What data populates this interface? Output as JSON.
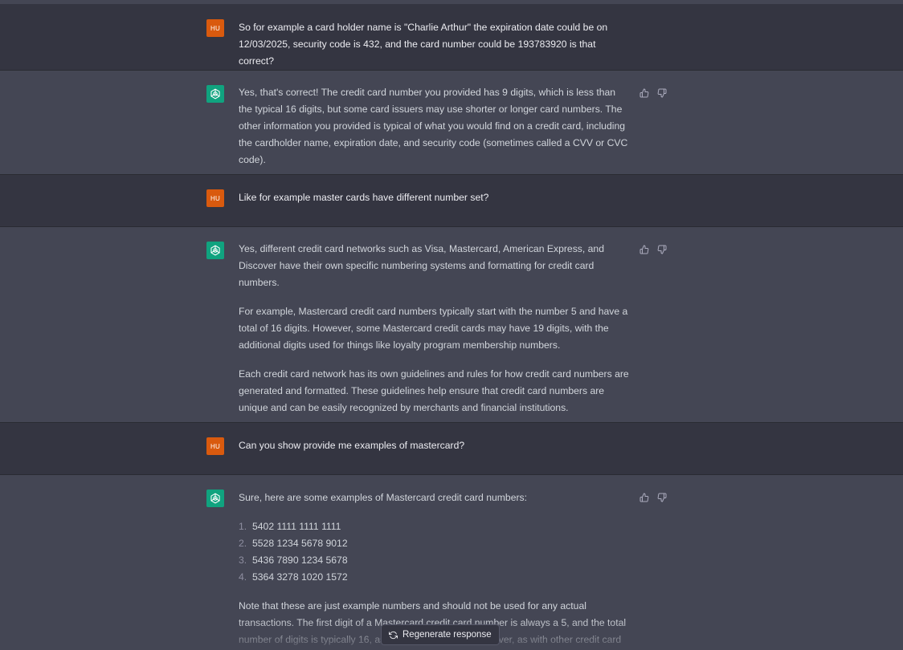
{
  "conversation": {
    "messages": [
      {
        "role": "user",
        "avatar_text": "HU",
        "paragraphs": [
          "So for example a card holder name is \"Charlie Arthur\" the expiration date could be on 12/03/2025, security code is 432, and the card number could be 193783920 is that correct?"
        ]
      },
      {
        "role": "assistant",
        "paragraphs": [
          "Yes, that's correct! The credit card number you provided has 9 digits, which is less than the typical 16 digits, but some card issuers may use shorter or longer card numbers. The other information you provided is typical of what you would find on a credit card, including the cardholder name, expiration date, and security code (sometimes called a CVV or CVC code)."
        ]
      },
      {
        "role": "user",
        "avatar_text": "HU",
        "paragraphs": [
          "Like for example master cards have different number set?"
        ]
      },
      {
        "role": "assistant",
        "paragraphs": [
          "Yes, different credit card networks such as Visa, Mastercard, American Express, and Discover have their own specific numbering systems and formatting for credit card numbers.",
          "For example, Mastercard credit card numbers typically start with the number 5 and have a total of 16 digits. However, some Mastercard credit cards may have 19 digits, with the additional digits used for things like loyalty program membership numbers.",
          "Each credit card network has its own guidelines and rules for how credit card numbers are generated and formatted. These guidelines help ensure that credit card numbers are unique and can be easily recognized by merchants and financial institutions."
        ]
      },
      {
        "role": "user",
        "avatar_text": "HU",
        "paragraphs": [
          "Can you show provide me examples of mastercard?"
        ]
      },
      {
        "role": "assistant",
        "intro": "Sure, here are some examples of Mastercard credit card numbers:",
        "list": [
          {
            "num": "1.",
            "text": "5402 1111 1111 1111"
          },
          {
            "num": "2.",
            "text": "5528 1234 5678 9012"
          },
          {
            "num": "3.",
            "text": "5436 7890 1234 5678"
          },
          {
            "num": "4.",
            "text": "5364 3278 1020 1572"
          }
        ],
        "outro": "Note that these are just example numbers and should not be used for any actual transactions. The first digit of a Mastercard credit card number is always a 5, and the total number of digits is typically 16, as I mentioned earlier. However, as with other credit card"
      }
    ]
  },
  "actions": {
    "regenerate_label": "Regenerate response",
    "regenerate_icon": "refresh-icon"
  },
  "feedback_icons": [
    "thumbs-up-icon",
    "thumbs-down-icon"
  ],
  "colors": {
    "user_bg": "#343541",
    "assistant_bg": "#444654",
    "user_avatar": "#d95a0e",
    "assistant_avatar": "#10a37f"
  }
}
